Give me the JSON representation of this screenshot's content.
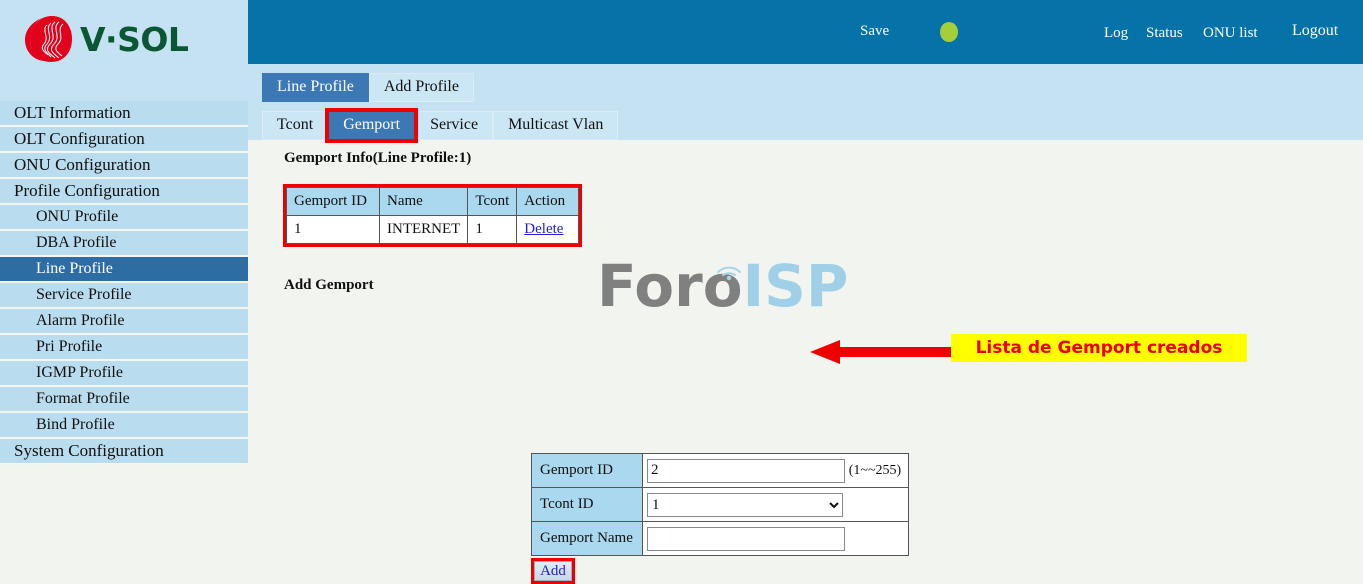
{
  "brand": {
    "name": "V·SOL",
    "logo_icon": "vsol-swirl-logo",
    "logo_color": "#e2001a",
    "text_color": "#0c5733"
  },
  "header": {
    "bg_color": "#0673a8",
    "save_label": "Save",
    "indicator_icon": "status-indicator-circle",
    "indicator_color": "#a6ce39",
    "links": [
      {
        "label": "Log"
      },
      {
        "label": "Status"
      },
      {
        "label": "ONU list"
      },
      {
        "label": "Logout"
      }
    ]
  },
  "sidebar": {
    "bg_color": "#b9dcef",
    "active_color": "#2e6da4",
    "items": [
      {
        "label": "OLT Information",
        "level": 0,
        "active": false
      },
      {
        "label": "OLT Configuration",
        "level": 0,
        "active": false
      },
      {
        "label": "ONU Configuration",
        "level": 0,
        "active": false
      },
      {
        "label": "Profile Configuration",
        "level": 0,
        "active": false
      },
      {
        "label": "ONU Profile",
        "level": 1,
        "active": false
      },
      {
        "label": "DBA Profile",
        "level": 1,
        "active": false
      },
      {
        "label": "Line Profile",
        "level": 1,
        "active": true
      },
      {
        "label": "Service Profile",
        "level": 1,
        "active": false
      },
      {
        "label": "Alarm Profile",
        "level": 1,
        "active": false
      },
      {
        "label": "Pri Profile",
        "level": 1,
        "active": false
      },
      {
        "label": "IGMP Profile",
        "level": 1,
        "active": false
      },
      {
        "label": "Format Profile",
        "level": 1,
        "active": false
      },
      {
        "label": "Bind Profile",
        "level": 1,
        "active": false
      },
      {
        "label": "System Configuration",
        "level": 0,
        "active": false
      }
    ]
  },
  "tabs": {
    "primary": [
      {
        "label": "Line Profile",
        "active": true
      },
      {
        "label": "Add Profile",
        "active": false
      }
    ],
    "secondary": [
      {
        "label": "Tcont",
        "active": false,
        "annotated": false
      },
      {
        "label": "Gemport",
        "active": true,
        "annotated": true
      },
      {
        "label": "Service",
        "active": false,
        "annotated": false
      },
      {
        "label": "Multicast Vlan",
        "active": false,
        "annotated": false
      }
    ]
  },
  "main": {
    "info_title": "Gemport Info(Line Profile:1)",
    "table": {
      "headers": [
        "Gemport ID",
        "Name",
        "Tcont",
        "Action"
      ],
      "rows": [
        {
          "gemport_id": "1",
          "name": "INTERNET",
          "tcont": "1",
          "action": "Delete"
        }
      ]
    },
    "add_title": "Add Gemport",
    "form": {
      "gemport_id_label": "Gemport ID",
      "gemport_id_value": "2",
      "gemport_id_hint": "(1~~255)",
      "tcont_id_label": "Tcont ID",
      "tcont_id_value": "1",
      "tcont_id_options": [
        "1"
      ],
      "gemport_name_label": "Gemport Name",
      "gemport_name_value": "",
      "gemport_name_placeholder": ""
    },
    "add_button_label": "Add"
  },
  "annotations": {
    "callout_text": "Lista de Gemport creados",
    "callout_bg": "#ffff00",
    "callout_fg": "#ee0000",
    "highlight_color": "#ee0000",
    "arrow_icon": "left-arrow-annotation"
  },
  "watermark": {
    "text_primary": "Foro",
    "text_secondary": "ISP",
    "icon": "broadcast-tower-icon",
    "primary_color": "#808080",
    "secondary_color": "#9fd0e8"
  }
}
